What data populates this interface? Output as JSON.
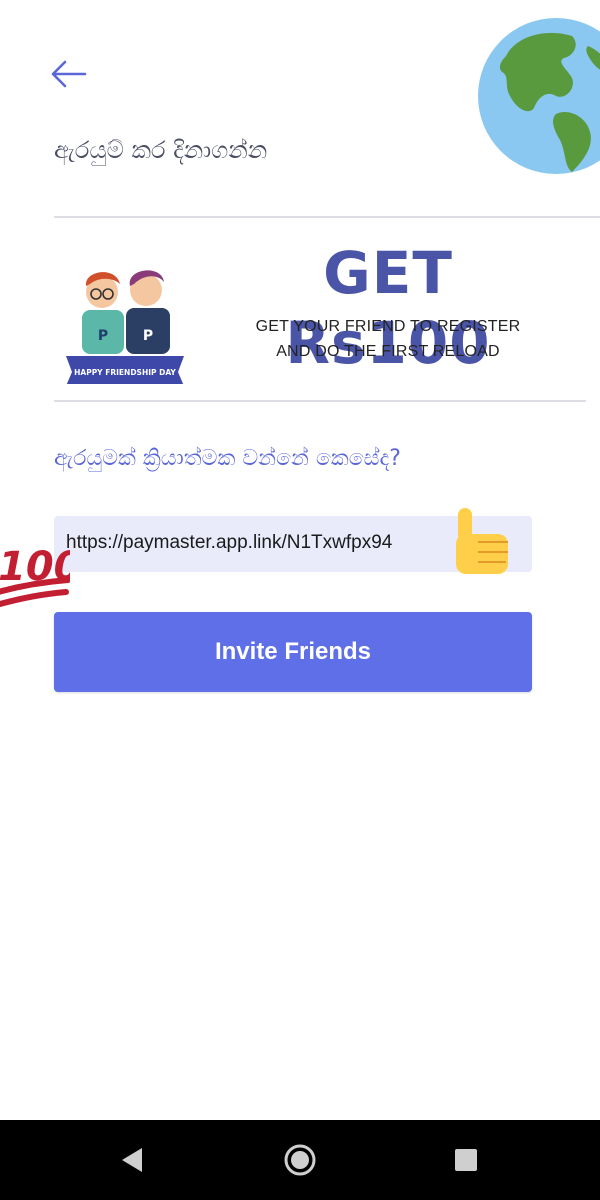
{
  "header": {
    "title": "ඇරයුම් කර දිනාගන්න",
    "back_icon": "arrow-left-icon",
    "decoration_icon": "globe-icon"
  },
  "banner": {
    "headline": "GET Rs100",
    "line1": "GET YOUR FRIEND TO REGISTER",
    "line2": "AND DO THE FIRST RELOAD",
    "ribbon_text": "HAPPY FRIENDSHIP DAY",
    "shirt_letter": "P"
  },
  "how_it_works": {
    "title": "ඇරයුමක් ක්‍රියාත්මක වන්නේ කෙසේද?"
  },
  "referral": {
    "link": "https://paymaster.app.link/N1Txwfpx94",
    "decor_icons": [
      "thumbs-up-icon",
      "hundred-points-icon"
    ]
  },
  "actions": {
    "invite_label": "Invite Friends"
  },
  "navbar": {
    "icons": [
      "nav-back-icon",
      "nav-home-icon",
      "nav-recents-icon"
    ]
  },
  "colors": {
    "accent": "#5F6FE8",
    "headline": "#4A55A8",
    "link_box_bg": "#E9EBFB",
    "nav_bar": "#000000"
  }
}
